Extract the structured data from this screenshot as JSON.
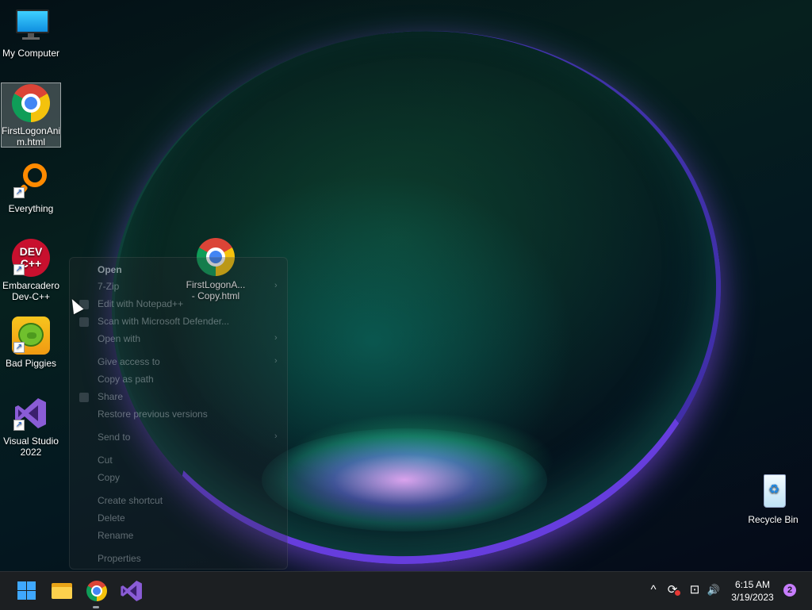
{
  "desktop": {
    "icons": [
      {
        "label": "My Computer",
        "icon": "monitor-icon"
      },
      {
        "label": "FirstLogonAni m.html",
        "icon": "chrome-icon",
        "selected": true
      },
      {
        "label": "Everything",
        "icon": "everything-search-icon",
        "shortcut": true
      },
      {
        "label": "Embarcadero Dev-C++",
        "icon": "devcpp-icon",
        "shortcut": true
      },
      {
        "label": "Bad Piggies",
        "icon": "bad-piggies-icon",
        "shortcut": true
      },
      {
        "label": "Visual Studio 2022",
        "icon": "visual-studio-icon",
        "shortcut": true
      }
    ],
    "dragged_icon": {
      "label": "FirstLogonA... - Copy.html",
      "icon": "chrome-icon"
    },
    "recycle_bin": {
      "label": "Recycle Bin",
      "icon": "recycle-bin-icon"
    }
  },
  "context_menu": {
    "items": [
      {
        "label": "Open",
        "bold": true
      },
      {
        "label": "7-Zip",
        "submenu": true
      },
      {
        "label": "Edit with Notepad++",
        "icon": "notepadpp-icon"
      },
      {
        "label": "Scan with Microsoft Defender...",
        "icon": "defender-icon"
      },
      {
        "label": "Open with",
        "submenu": true
      },
      {
        "label": "Give access to",
        "submenu": true
      },
      {
        "label": "Copy as path"
      },
      {
        "label": "Share",
        "icon": "share-icon"
      },
      {
        "label": "Restore previous versions"
      },
      {
        "label": "Send to",
        "submenu": true
      },
      {
        "label": "Cut"
      },
      {
        "label": "Copy"
      },
      {
        "label": "Create shortcut"
      },
      {
        "label": "Delete"
      },
      {
        "label": "Rename"
      },
      {
        "label": "Properties"
      }
    ],
    "submenu_arrow": "›"
  },
  "taskbar": {
    "apps": [
      {
        "name": "Start",
        "icon": "windows-start-icon"
      },
      {
        "name": "File Explorer",
        "icon": "folder-icon"
      },
      {
        "name": "Google Chrome",
        "icon": "chrome-icon",
        "running": true
      },
      {
        "name": "Visual Studio",
        "icon": "visual-studio-icon"
      }
    ],
    "tray": {
      "chevron": "^",
      "sync_glyph": "⟳",
      "network_glyph": "⊡",
      "volume_glyph": "🔊"
    },
    "clock": {
      "time": "6:15 AM",
      "date": "3/19/2023"
    },
    "notification_count": "2"
  },
  "colors": {
    "taskbar_bg": "#1c1f22",
    "accent": "#3fa8ff",
    "notification_badge": "#c77dff"
  }
}
